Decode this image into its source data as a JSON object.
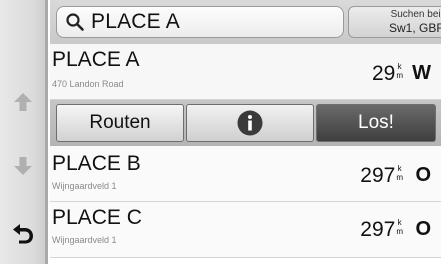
{
  "search": {
    "query": "PLACE A",
    "near_label": "Suchen bei:",
    "near_value": "Sw1, GBR"
  },
  "results": [
    {
      "name": "PLACE A",
      "address": "470 Landon Road",
      "distance": "29",
      "unit_top": "k",
      "unit_bottom": "m",
      "direction": "W"
    },
    {
      "name": "PLACE B",
      "address": "Wijngaardveld 1",
      "distance": "297",
      "unit_top": "k",
      "unit_bottom": "m",
      "direction": "O"
    },
    {
      "name": "PLACE C",
      "address": "Wijngaardveld 1",
      "distance": "297",
      "unit_top": "k",
      "unit_bottom": "m",
      "direction": "O"
    }
  ],
  "actions": {
    "route_label": "Routen",
    "info_icon": "info-icon",
    "go_label": "Los!"
  },
  "icons": {
    "search": "search-icon",
    "scroll_up": "arrow-up-icon",
    "scroll_down": "arrow-down-icon",
    "back": "back-arrow-icon"
  },
  "colors": {
    "go_button": "#4a4a4a",
    "background": "#fafafa"
  }
}
